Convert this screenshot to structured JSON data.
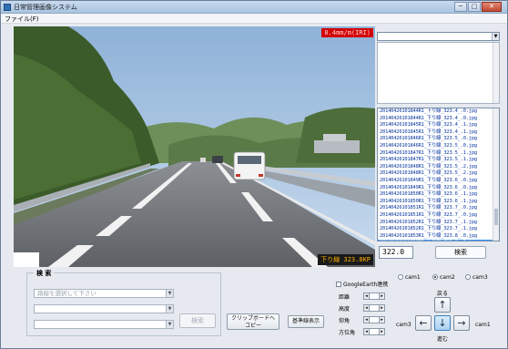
{
  "window": {
    "title": "日常管理画像システム",
    "min_label": "─",
    "max_label": "□",
    "close_label": "✕"
  },
  "menu": {
    "file_label": "ファイル(F)"
  },
  "video": {
    "iri_overlay": "8.4mm/m(IRI)",
    "position_overlay": "下り線 323.8KP"
  },
  "frame_list": {
    "rows": [
      "20140426101844R1_下り線_323.4_.0.jpg",
      "20140426101844R1_下り線_323.4_.0.jpg",
      "20140426101845R1_下り線_323.4_.1.jpg",
      "20140426101845R1_下り線_323.4_.1.jpg",
      "20140426101846R1_下り線_323.5_.0.jpg",
      "20140426101846R1_下り線_323.5_.0.jpg",
      "20140426101847R1_下り線_323.5_.1.jpg",
      "20140426101847R1_下り線_323.5_.1.jpg",
      "20140426101848R1_下り線_323.5_.2.jpg",
      "20140426101848R1_下り線_323.5_.2.jpg",
      "20140426101849R1_下り線_323.6_.0.jpg",
      "20140426101849R1_下り線_323.6_.0.jpg",
      "20140426101850R1_下り線_323.6_.1.jpg",
      "20140426101850R1_下り線_323.6_.1.jpg",
      "20140426101851R1_下り線_323.7_.0.jpg",
      "20140426101851R1_下り線_323.7_.0.jpg",
      "20140426101852R1_下り線_323.7_.1.jpg",
      "20140426101852R1_下り線_323.7_.1.jpg",
      "20140426101853R1_下り線_323.8_.0.jpg",
      "20140426101853R1_下り線_323.8_.0.jpg"
    ],
    "selected_index": 19
  },
  "position_field": {
    "value": "322.0"
  },
  "search_button_right": {
    "label": "検索"
  },
  "search_group": {
    "title": "検 索",
    "combo1_placeholder": "路線を選択して下さい",
    "combo2_placeholder": "",
    "combo3_placeholder": "",
    "search_label": "検索"
  },
  "buttons": {
    "clipboard_line1": "クリップボードへ",
    "clipboard_line2": "コピー",
    "standard_display": "基準線表示"
  },
  "map_controls": {
    "google_earth_label": "GoogleEarth連携",
    "cam_options": [
      "cam1",
      "cam2",
      "cam3"
    ],
    "selected_cam": "cam2",
    "params": [
      "距離",
      "高度",
      "仰角",
      "方位角"
    ],
    "nav_back_label": "戻る",
    "nav_forward_label": "進む",
    "cam_left_label": "cam3",
    "cam_right_label": "cam1"
  },
  "icons": {
    "up": "up-arrow-icon",
    "down": "down-arrow-icon",
    "left": "left-arrow-icon",
    "right": "right-arrow-icon"
  },
  "colors": {
    "iri_bg": "#d30000",
    "kp_text": "#ffb000",
    "selected_row": "#3399ff"
  }
}
